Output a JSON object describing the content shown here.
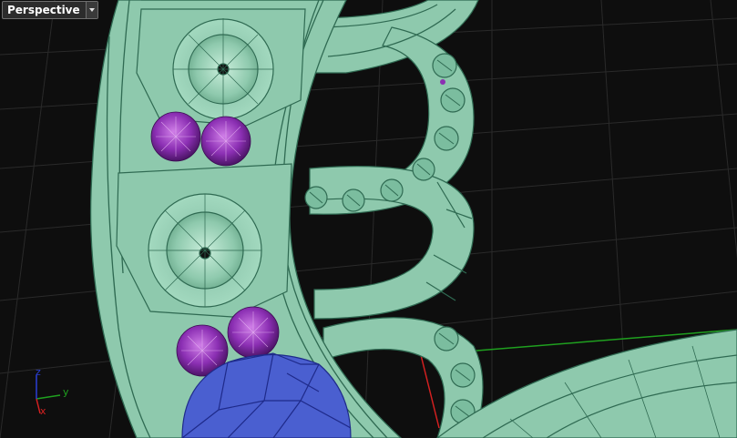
{
  "viewport": {
    "name": "Perspective",
    "dropdown_icon": "chevron-down-icon"
  },
  "axis_gizmo": {
    "x_label": "x",
    "y_label": "y",
    "z_label": "z",
    "x_color": "#d42020",
    "y_color": "#1fa01f",
    "z_color": "#2a3fd6"
  },
  "colors": {
    "background": "#0e0e0e",
    "grid": "#2a2a2a",
    "model_fill": "#8ec9ad",
    "model_edge": "#2f6a52",
    "gem_purple": "#8b2fb3",
    "gem_blue": "#4a5fd0",
    "world_x_axis": "#d42020",
    "world_y_axis": "#1fa01f"
  }
}
